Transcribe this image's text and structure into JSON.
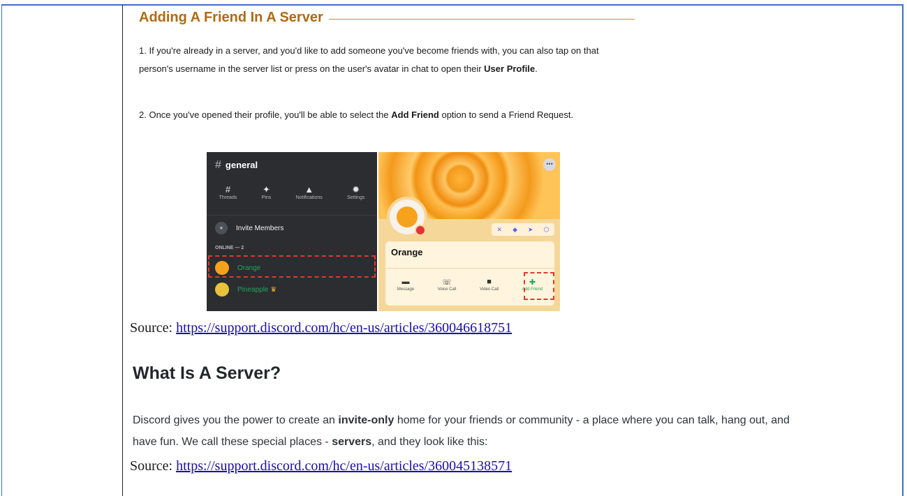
{
  "section1": {
    "title": "Adding A Friend In A Server",
    "step1_start": "1. If you're already in a server, and you'd like to add someone you've become friends with, you can also tap on that person's username in the server list or press on the user's avatar in chat to open their ",
    "step1_bold": "User Profile",
    "step1_end": ".",
    "step2_start": "2. Once you've opened their profile, you'll be able to select the ",
    "step2_bold": "Add Friend",
    "step2_end": " option to send a Friend Request."
  },
  "screenshot_left": {
    "channel": "general",
    "tools": [
      "Threads",
      "Pins",
      "Notifications",
      "Settings"
    ],
    "invite": "Invite Members",
    "online_header": "ONLINE — 2",
    "members": [
      "Orange",
      "Pineapple"
    ]
  },
  "screenshot_right": {
    "profile_name": "Orange",
    "actions": [
      "Message",
      "Voice Call",
      "Video Call",
      "Add Friend"
    ]
  },
  "source1": {
    "label": "Source: ",
    "url": "https://support.discord.com/hc/en-us/articles/360046618751"
  },
  "section2": {
    "heading": "What Is A Server?",
    "text_start": "Discord gives you the power to create an ",
    "bold1": "invite-only",
    "text_mid": " home for your friends or community - a place where you can talk, hang out, and have fun. We call these special places - ",
    "bold2": "servers",
    "text_end": ", and they look like this:"
  },
  "source2": {
    "label": "Source: ",
    "url": "https://support.discord.com/hc/en-us/articles/360045138571"
  }
}
